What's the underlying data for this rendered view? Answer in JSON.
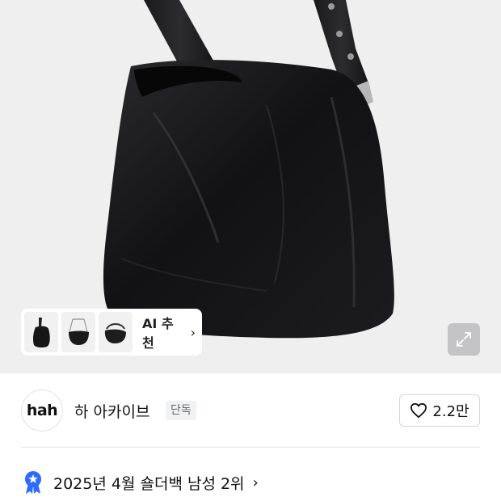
{
  "product": {
    "image": {
      "alt_icon": "black-leather-shoulder-bag-image",
      "background_color": "#efeff0",
      "expand_icon": "expand-arrows-icon"
    },
    "ai_recommend": {
      "label": "AI 추천",
      "chevron": "›",
      "thumbnails": [
        "bag-thumbnail-1",
        "bag-thumbnail-2",
        "bag-thumbnail-3"
      ]
    }
  },
  "brand": {
    "logo_text": "hah",
    "name": "하 아카이브",
    "badge": "단독",
    "like_icon": "heart-icon",
    "like_count": "2.2만"
  },
  "ranking": {
    "icon": "ribbon-star-icon",
    "accent": "#2f6bff",
    "text": "2025년 4월 숄더백 남성 2위",
    "chevron": "›"
  }
}
